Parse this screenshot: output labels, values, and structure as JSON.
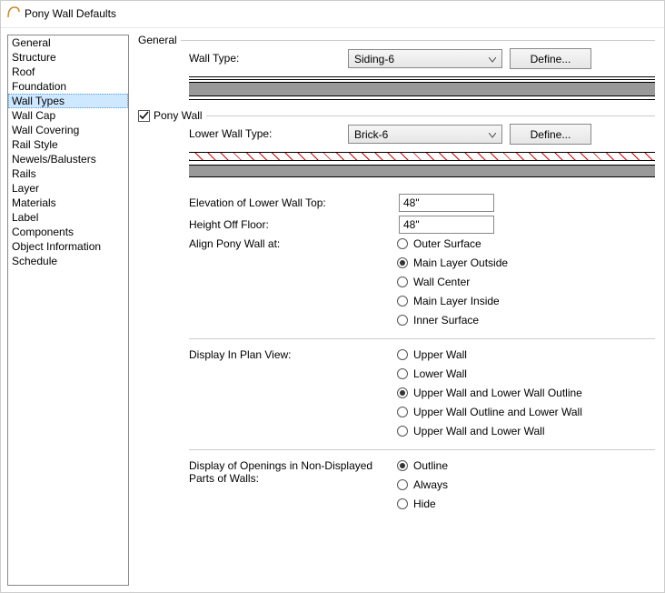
{
  "window": {
    "title": "Pony Wall Defaults"
  },
  "sidebar": {
    "items": [
      {
        "label": "General"
      },
      {
        "label": "Structure"
      },
      {
        "label": "Roof"
      },
      {
        "label": "Foundation"
      },
      {
        "label": "Wall Types"
      },
      {
        "label": "Wall Cap"
      },
      {
        "label": "Wall Covering"
      },
      {
        "label": "Rail Style"
      },
      {
        "label": "Newels/Balusters"
      },
      {
        "label": "Rails"
      },
      {
        "label": "Layer"
      },
      {
        "label": "Materials"
      },
      {
        "label": "Label"
      },
      {
        "label": "Components"
      },
      {
        "label": "Object Information"
      },
      {
        "label": "Schedule"
      }
    ],
    "selected_index": 4
  },
  "general": {
    "group_label": "General",
    "wall_type_label": "Wall Type:",
    "wall_type_value": "Siding-6",
    "define_label": "Define..."
  },
  "pony": {
    "group_label": "Pony Wall",
    "checked": true,
    "lower_wall_type_label": "Lower Wall Type:",
    "lower_wall_type_value": "Brick-6",
    "define_label": "Define...",
    "elevation_label": "Elevation of Lower Wall Top:",
    "elevation_value": "48\"",
    "height_label": "Height Off Floor:",
    "height_value": "48\"",
    "align_label": "Align Pony Wall at:",
    "align_options": [
      {
        "label": "Outer Surface"
      },
      {
        "label": "Main Layer Outside"
      },
      {
        "label": "Wall Center"
      },
      {
        "label": "Main Layer Inside"
      },
      {
        "label": "Inner Surface"
      }
    ],
    "align_selected": 1,
    "display_plan_label": "Display In Plan View:",
    "display_plan_options": [
      {
        "label": "Upper Wall"
      },
      {
        "label": "Lower Wall"
      },
      {
        "label": "Upper Wall and Lower Wall Outline"
      },
      {
        "label": "Upper Wall Outline and Lower Wall"
      },
      {
        "label": "Upper Wall and Lower Wall"
      }
    ],
    "display_plan_selected": 2,
    "openings_label": "Display of Openings in Non-Displayed Parts of Walls:",
    "openings_options": [
      {
        "label": "Outline"
      },
      {
        "label": "Always"
      },
      {
        "label": "Hide"
      }
    ],
    "openings_selected": 0
  }
}
